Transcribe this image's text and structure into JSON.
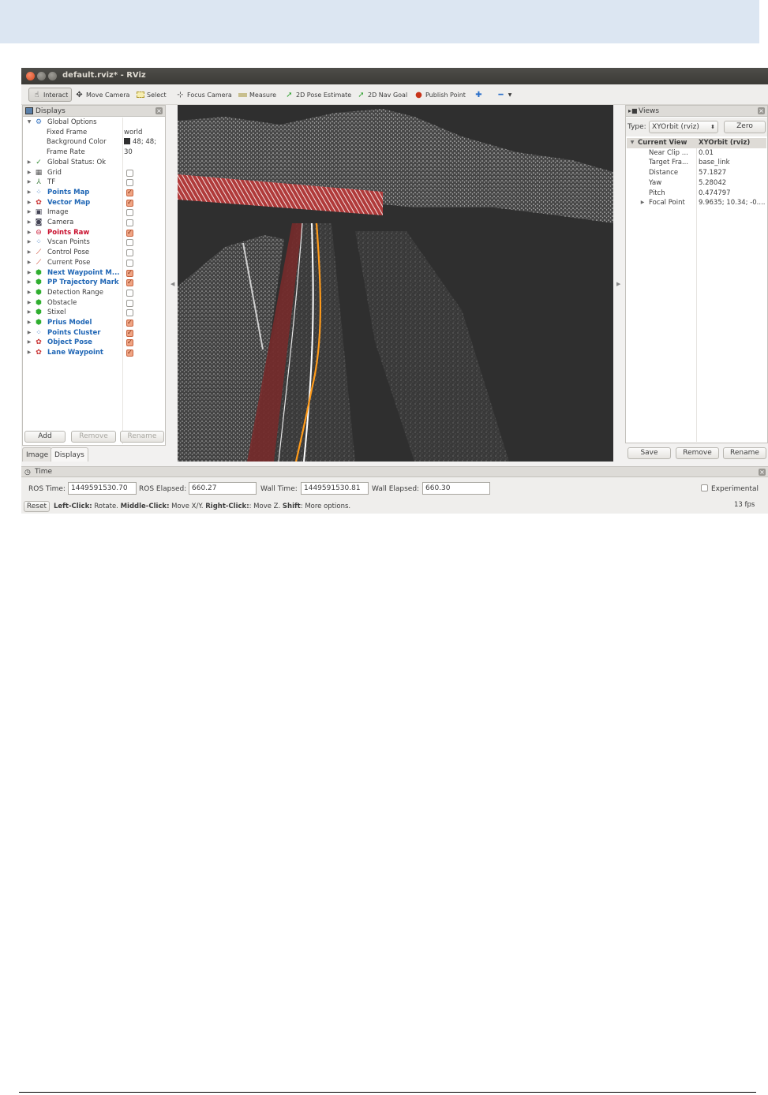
{
  "window": {
    "title": "default.rviz* - RViz"
  },
  "toolbar": {
    "tools": [
      {
        "label": "Interact",
        "icon": "hand-pointer-icon"
      },
      {
        "label": "Move Camera",
        "icon": "move-camera-icon"
      },
      {
        "label": "Select",
        "icon": "select-box-icon"
      },
      {
        "label": "Focus Camera",
        "icon": "focus-camera-icon"
      },
      {
        "label": "Measure",
        "icon": "ruler-icon"
      },
      {
        "label": "2D Pose Estimate",
        "icon": "green-arrow-icon"
      },
      {
        "label": "2D Nav Goal",
        "icon": "green-arrow-icon"
      },
      {
        "label": "Publish Point",
        "icon": "map-pin-icon"
      }
    ]
  },
  "displays": {
    "title": "Displays",
    "global_options": "Global Options",
    "fixed_frame_label": "Fixed Frame",
    "fixed_frame_value": "world",
    "bg_color_label": "Background Color",
    "bg_color_value": "48; 48;",
    "frame_rate_label": "Frame Rate",
    "frame_rate_value": "30",
    "global_status": "Global Status: Ok",
    "items": [
      {
        "label": "Grid",
        "checked": false,
        "style": "normal",
        "icon": "grid-icon"
      },
      {
        "label": "TF",
        "checked": false,
        "style": "normal",
        "icon": "tf-icon"
      },
      {
        "label": "Points Map",
        "checked": true,
        "style": "blue",
        "icon": "pointcloud-icon"
      },
      {
        "label": "Vector Map",
        "checked": true,
        "style": "blue",
        "icon": "marker-icon"
      },
      {
        "label": "Image",
        "checked": false,
        "style": "normal",
        "icon": "image-icon"
      },
      {
        "label": "Camera",
        "checked": false,
        "style": "normal",
        "icon": "camera-icon"
      },
      {
        "label": "Points Raw",
        "checked": true,
        "style": "red",
        "icon": "error-icon"
      },
      {
        "label": "Vscan Points",
        "checked": false,
        "style": "normal",
        "icon": "pointcloud-icon"
      },
      {
        "label": "Control Pose",
        "checked": false,
        "style": "normal",
        "icon": "pose-arrow-icon"
      },
      {
        "label": "Current Pose",
        "checked": false,
        "style": "normal",
        "icon": "pose-arrow-icon"
      },
      {
        "label": "Next Waypoint M...",
        "checked": true,
        "style": "blue",
        "icon": "green-cube-icon"
      },
      {
        "label": "PP Trajectory Mark",
        "checked": true,
        "style": "blue",
        "icon": "green-cube-icon"
      },
      {
        "label": "Detection Range",
        "checked": false,
        "style": "normal",
        "icon": "green-cube-icon"
      },
      {
        "label": "Obstacle",
        "checked": false,
        "style": "normal",
        "icon": "green-cube-icon"
      },
      {
        "label": "Stixel",
        "checked": false,
        "style": "normal",
        "icon": "green-cube-icon"
      },
      {
        "label": "Prius Model",
        "checked": true,
        "style": "blue",
        "icon": "green-cube-icon"
      },
      {
        "label": "Points Cluster",
        "checked": true,
        "style": "blue",
        "icon": "pointcloud-icon"
      },
      {
        "label": "Object Pose",
        "checked": true,
        "style": "blue",
        "icon": "marker-icon"
      },
      {
        "label": "Lane Waypoint",
        "checked": true,
        "style": "blue",
        "icon": "marker-icon"
      }
    ],
    "buttons": {
      "add": "Add",
      "remove": "Remove",
      "rename": "Rename"
    },
    "tabs": [
      "Image",
      "Displays"
    ]
  },
  "views": {
    "title": "Views",
    "type_label": "Type:",
    "type_value": "XYOrbit (rviz)",
    "zero": "Zero",
    "current_view_label": "Current View",
    "current_view_value": "XYOrbit (rviz)",
    "props": [
      {
        "label": "Near Clip ...",
        "value": "0.01"
      },
      {
        "label": "Target Fra...",
        "value": "base_link"
      },
      {
        "label": "Distance",
        "value": "57.1827"
      },
      {
        "label": "Yaw",
        "value": "5.28042"
      },
      {
        "label": "Pitch",
        "value": "0.474797"
      },
      {
        "label": "Focal Point",
        "value": "9.9635; 10.34; -0...."
      }
    ],
    "buttons": {
      "save": "Save",
      "remove": "Remove",
      "rename": "Rename"
    }
  },
  "time": {
    "title": "Time",
    "ros_time_label": "ROS Time:",
    "ros_time": "1449591530.70",
    "ros_elapsed_label": "ROS Elapsed:",
    "ros_elapsed": "660.27",
    "wall_time_label": "Wall Time:",
    "wall_time": "1449591530.81",
    "wall_elapsed_label": "Wall Elapsed:",
    "wall_elapsed": "660.30",
    "experimental": "Experimental"
  },
  "statusbar": {
    "reset": "Reset",
    "k1": "Left-Click:",
    "v1": " Rotate. ",
    "k2": "Middle-Click:",
    "v2": " Move X/Y. ",
    "k3": "Right-Click:",
    "v3": ": Move Z. ",
    "k4": "Shift",
    "v4": ": More options.",
    "fps": "13 fps"
  },
  "colors": {
    "accent_blue": "#1f66b5",
    "error_red": "#c8102e",
    "viewport_bg": "#303030",
    "lane_orange": "#ff9b1a"
  }
}
